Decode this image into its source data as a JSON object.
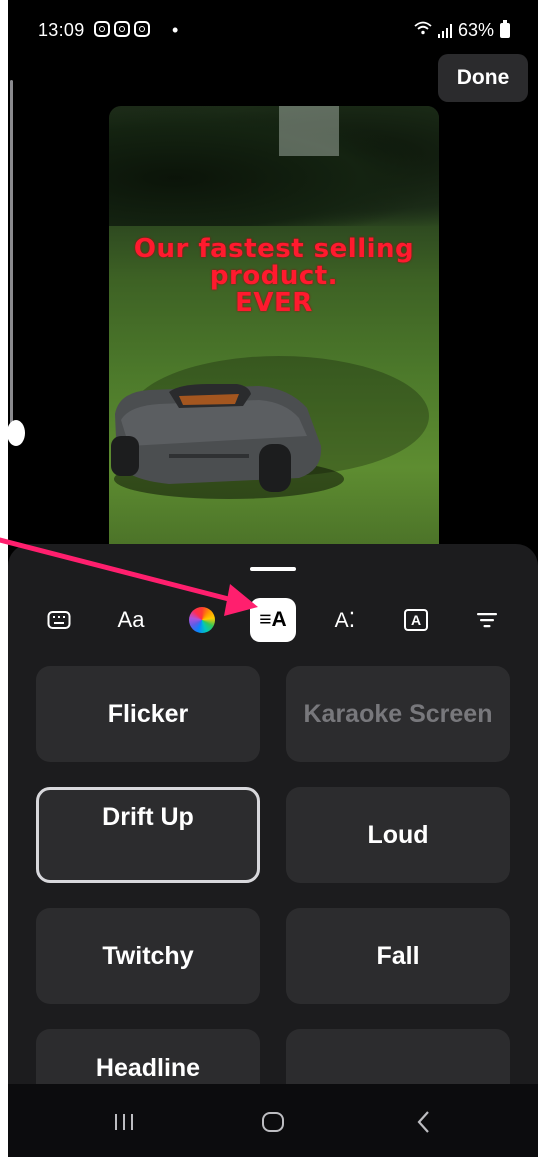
{
  "status_bar": {
    "time": "13:09",
    "dot": "•",
    "battery_percent": "63%",
    "notification_icons": [
      "instagram-icon",
      "instagram-icon",
      "instagram-icon"
    ]
  },
  "header": {
    "done_label": "Done"
  },
  "preview": {
    "caption_lines": [
      "Our fastest selling",
      "product.",
      "EVER"
    ]
  },
  "toolbar": {
    "items": [
      {
        "name": "keyboard-icon",
        "label": ""
      },
      {
        "name": "font-style",
        "label": "Aa"
      },
      {
        "name": "color-picker-icon",
        "label": ""
      },
      {
        "name": "text-animation",
        "label": "≡A"
      },
      {
        "name": "text-effects",
        "label": "A⁚"
      },
      {
        "name": "text-background",
        "label": "A"
      },
      {
        "name": "alignment-icon",
        "label": ""
      }
    ],
    "active": "text-animation"
  },
  "effects": [
    {
      "label": "Flicker",
      "state": "normal"
    },
    {
      "label": "Karaoke Screen",
      "state": "disabled"
    },
    {
      "label": "Drift Up",
      "state": "selected"
    },
    {
      "label": "Loud",
      "state": "normal"
    },
    {
      "label": "Twitchy",
      "state": "normal"
    },
    {
      "label": "Fall",
      "state": "normal"
    },
    {
      "label": "Headline",
      "state": "normal"
    },
    {
      "label": "",
      "state": "normal"
    }
  ],
  "colors": {
    "accent_arrow": "#ff1f6e",
    "caption": "#ff1a2e"
  }
}
